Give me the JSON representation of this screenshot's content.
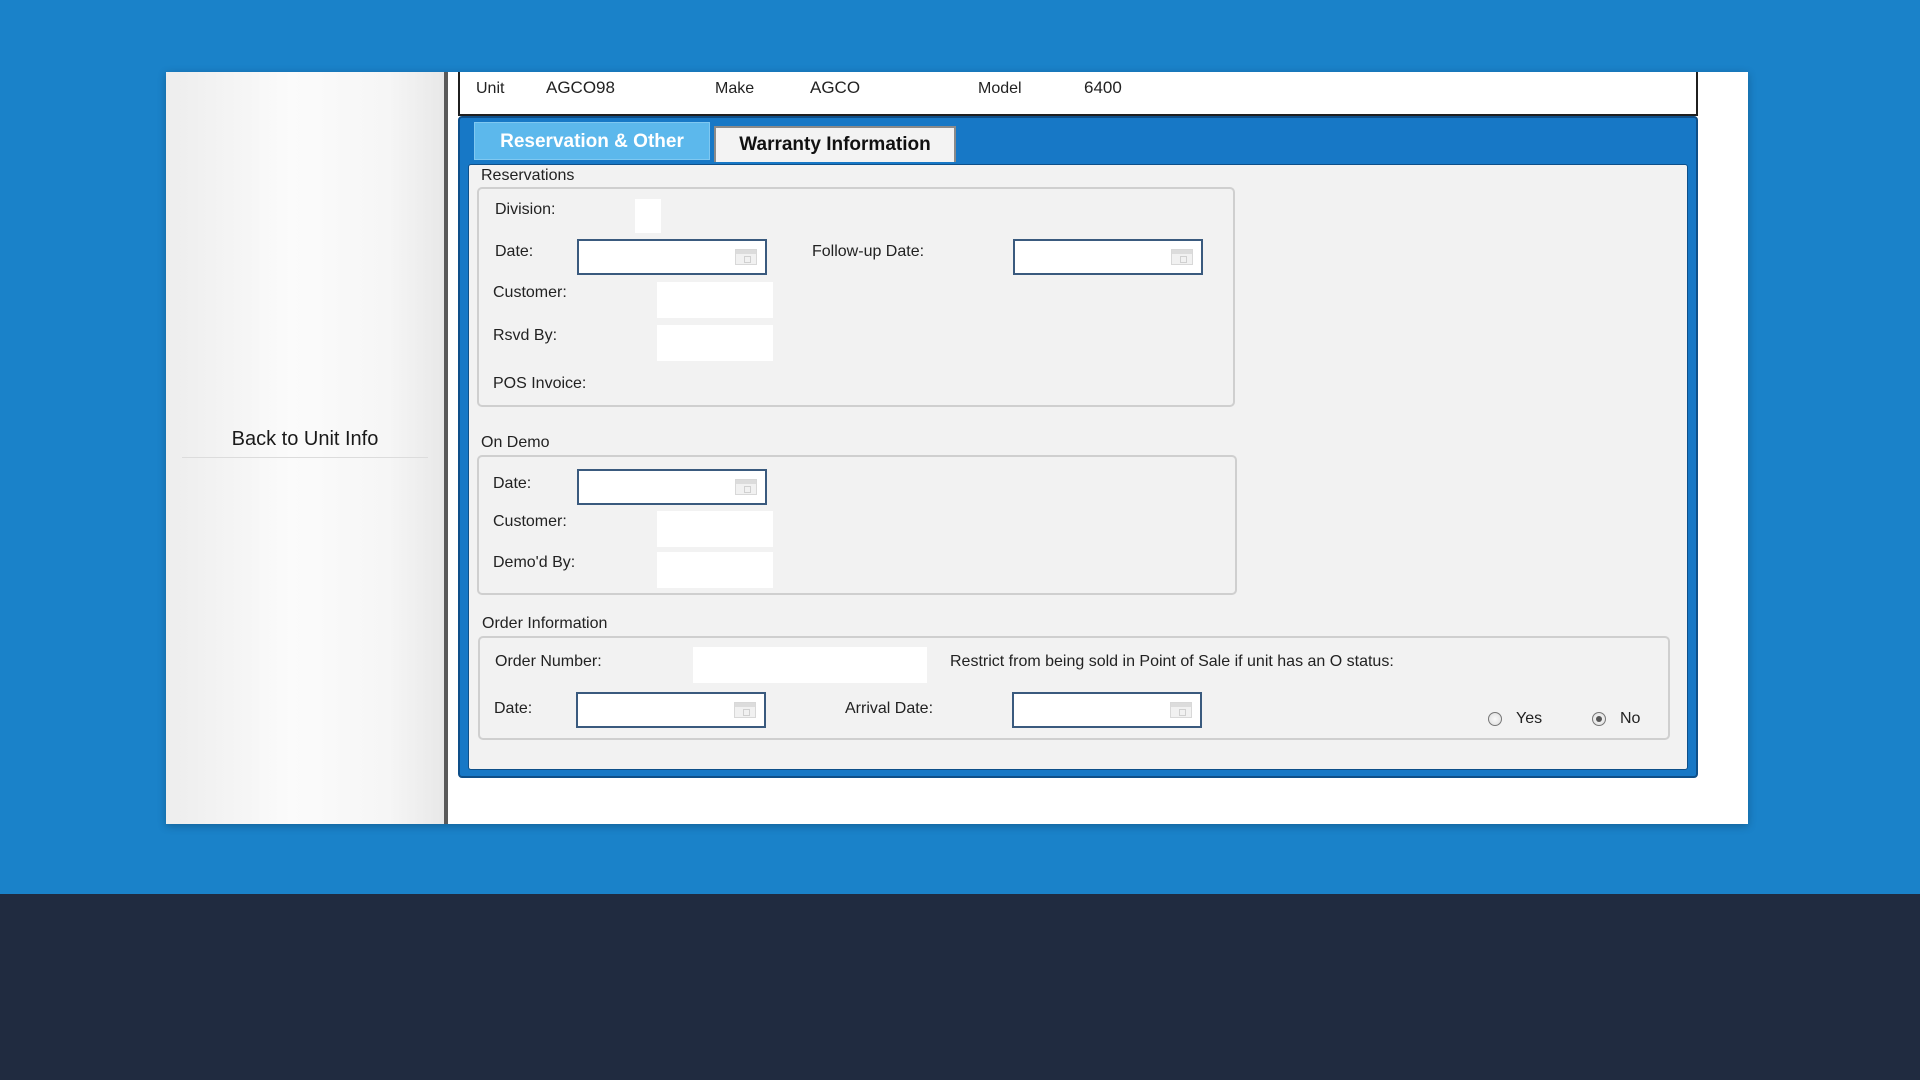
{
  "sidebar": {
    "back_link": "Back to Unit Info"
  },
  "unit_header": {
    "unit_label": "Unit",
    "unit_value": "AGCO98",
    "make_label": "Make",
    "make_value": "AGCO",
    "model_label": "Model",
    "model_value": "6400"
  },
  "tabs": [
    {
      "label": "Reservation & Other",
      "active": true
    },
    {
      "label": "Warranty Information",
      "active": false
    }
  ],
  "reservations": {
    "title": "Reservations",
    "division_label": "Division:",
    "date_label": "Date:",
    "date_value": "",
    "followup_label": "Follow-up Date:",
    "followup_value": "",
    "customer_label": "Customer:",
    "customer_value": "",
    "rsvd_by_label": "Rsvd By:",
    "rsvd_by_value": "",
    "pos_invoice_label": "POS Invoice:"
  },
  "on_demo": {
    "title": "On Demo",
    "date_label": "Date:",
    "date_value": "",
    "customer_label": "Customer:",
    "customer_value": "",
    "demod_by_label": "Demo'd By:",
    "demod_by_value": ""
  },
  "order_info": {
    "title": "Order Information",
    "order_number_label": "Order Number:",
    "order_number_value": "",
    "restrict_label": "Restrict from being sold in Point of Sale if unit has an O status:",
    "date_label": "Date:",
    "date_value": "",
    "arrival_label": "Arrival Date:",
    "arrival_value": "",
    "yes_label": "Yes",
    "no_label": "No",
    "restrict_selected": "No"
  },
  "colors": {
    "background": "#1a82c9",
    "bottom_band": "#202b40",
    "active_tab": "#5cb8ec",
    "panel": "#1778c6"
  }
}
